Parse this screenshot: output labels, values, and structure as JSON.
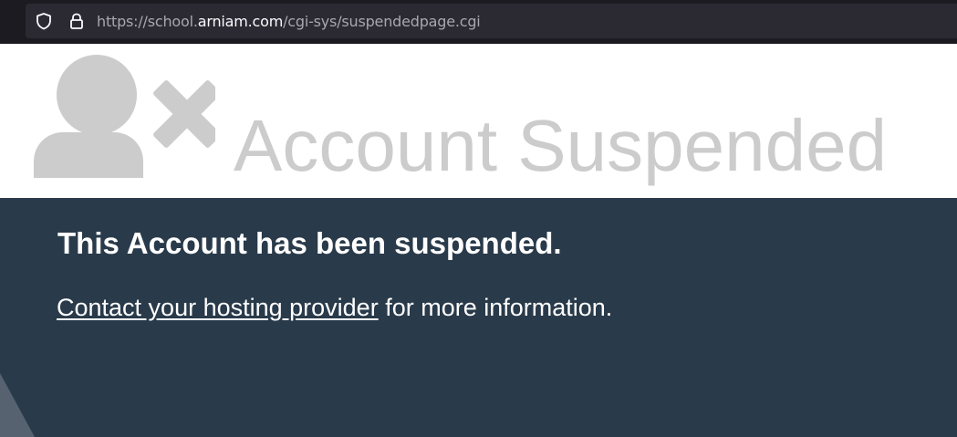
{
  "browser": {
    "url_prefix": "https://school.",
    "url_domain": "arniam.com",
    "url_path": "/cgi-sys/suspendedpage.cgi"
  },
  "header": {
    "title": "Account Suspended",
    "icon": "user-remove-icon"
  },
  "content": {
    "heading": "This Account has been suspended.",
    "link_text": "Contact your hosting provider",
    "after_link_text": " for more information."
  },
  "colors": {
    "browser_bg": "#1c1b22",
    "url_field_bg": "#2b2a33",
    "title_gray": "#cccccc",
    "content_bg": "#293a4a",
    "text_white": "#ffffff"
  }
}
